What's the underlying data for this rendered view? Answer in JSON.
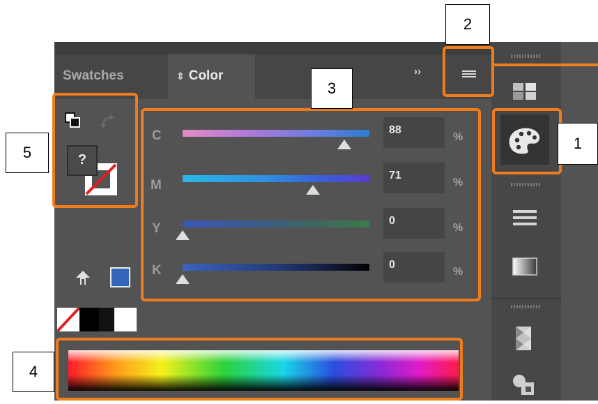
{
  "tabs": {
    "swatches": "Swatches",
    "color": "Color",
    "color_icon": "⇕"
  },
  "overflow": "››",
  "sliders": [
    {
      "channel": "C",
      "value": "88",
      "unit": "%",
      "fraction": 0.88
    },
    {
      "channel": "M",
      "value": "71",
      "unit": "%",
      "fraction": 0.71
    },
    {
      "channel": "Y",
      "value": "0",
      "unit": "%",
      "fraction": 0
    },
    {
      "channel": "K",
      "value": "0",
      "unit": "%",
      "fraction": 0
    }
  ],
  "fill_stroke": {
    "question": "?"
  },
  "callouts": {
    "c1": "1",
    "c2": "2",
    "c3": "3",
    "c4": "4",
    "c5": "5"
  },
  "colors": {
    "accent_orange": "#f07d1c",
    "current_color": "#3366b8",
    "panel_bg": "#535353"
  },
  "icons": [
    "panel-menu-icon",
    "swatches-grid-icon",
    "color-palette-icon",
    "stroke-lines-icon",
    "gradient-icon",
    "transparency-icon",
    "appearance-icon",
    "swap-arrows-icon",
    "default-fill-stroke-icon",
    "out-of-gamut-icon"
  ]
}
